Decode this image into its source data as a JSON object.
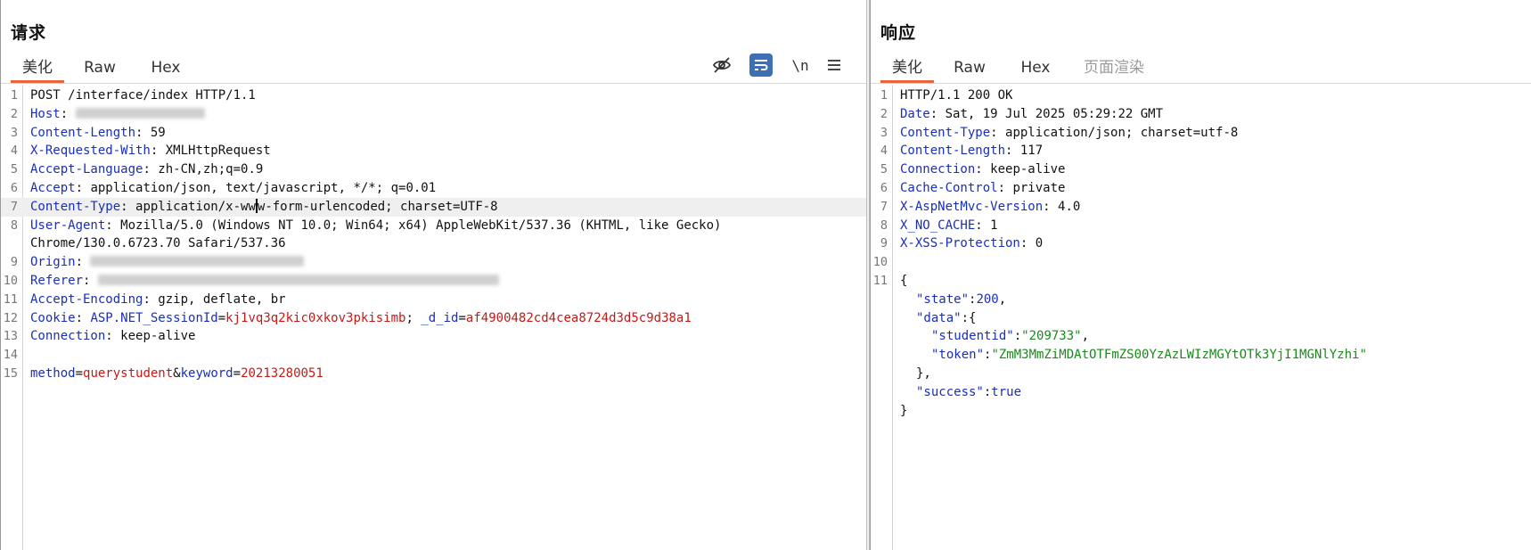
{
  "request": {
    "title": "请求",
    "tabs": [
      "美化",
      "Raw",
      "Hex"
    ],
    "active_tab": "美化",
    "toolbar": {
      "hide_icon": "eye-slash-icon",
      "wrap_icon": "wrap-lines-icon",
      "newline_label": "\\n",
      "menu_icon": "hamburger-menu-icon"
    },
    "line_numbers": [
      "1",
      "2",
      "3",
      "4",
      "5",
      "6",
      "7",
      "8",
      "",
      "9",
      "10",
      "11",
      "12",
      "13",
      "14",
      "15"
    ],
    "lines": {
      "l1": "POST /interface/index HTTP/1.1",
      "l2_key": "Host",
      "l3_key": "Content-Length",
      "l3_val": " 59",
      "l4_key": "X-Requested-With",
      "l4_val": " XMLHttpRequest",
      "l5_key": "Accept-Language",
      "l5_val": " zh-CN,zh;q=0.9",
      "l6_key": "Accept",
      "l6_val": " application/json, text/javascript, */*; q=0.01",
      "l7_key": "Content-Type",
      "l7_val_a": " application/x-ww",
      "l7_val_b": "w-form-urlencoded; charset=UTF-8",
      "l8_key": "User-Agent",
      "l8_val": " Mozilla/5.0 (Windows NT 10.0; Win64; x64) AppleWebKit/537.36 (KHTML, like Gecko)",
      "l8_cont": "Chrome/130.0.6723.70 Safari/537.36",
      "l9_key": "Origin",
      "l10_key": "Referer",
      "l11_key": "Accept-Encoding",
      "l11_val": " gzip, deflate, br",
      "l12_key": "Cookie",
      "l12_c1": " ASP.NET_SessionId",
      "l12_eq1": "=",
      "l12_v1": "kj1vq3q2kic0xkov3pkisimb",
      "l12_sep": "; ",
      "l12_c2": "_d_id",
      "l12_eq2": "=",
      "l12_v2": "af4900482cd4cea8724d3d5c9d38a1",
      "l13_key": "Connection",
      "l13_val": " keep-alive",
      "l15_p1": "method",
      "l15_eq1": "=",
      "l15_v1": "querystudent",
      "l15_amp": "&",
      "l15_p2": "keyword",
      "l15_eq2": "=",
      "l15_v2": "20213280051"
    }
  },
  "response": {
    "title": "响应",
    "tabs": [
      "美化",
      "Raw",
      "Hex",
      "页面渲染"
    ],
    "active_tab": "美化",
    "line_numbers": [
      "1",
      "2",
      "3",
      "4",
      "5",
      "6",
      "7",
      "8",
      "9",
      "10",
      "11"
    ],
    "lines": {
      "l1": "HTTP/1.1 200 OK",
      "l2_key": "Date",
      "l2_val": " Sat, 19 Jul 2025 05:29:22 GMT",
      "l3_key": "Content-Type",
      "l3_val": " application/json; charset=utf-8",
      "l4_key": "Content-Length",
      "l4_val": " 117",
      "l5_key": "Connection",
      "l5_val": " keep-alive",
      "l6_key": "Cache-Control",
      "l6_val": " private",
      "l7_key": "X-AspNetMvc-Version",
      "l7_val": " 4.0",
      "l8_key": "X_NO_CACHE",
      "l8_val": " 1",
      "l9_key": "X-XSS-Protection",
      "l9_val": " 0",
      "j_open": "{",
      "j_state_key": "\"state\"",
      "j_state_val": "200",
      "j_data_key": "\"data\"",
      "j_sid_key": "\"studentid\"",
      "j_sid_val": "\"209733\"",
      "j_token_key": "\"token\"",
      "j_token_val": "\"ZmM3MmZiMDAtOTFmZS00YzAzLWIzMGYtOTk3YjI1MGNlYzhi\"",
      "j_data_close": "},",
      "j_success_key": "\"success\"",
      "j_success_val": "true",
      "j_close": "}"
    }
  }
}
